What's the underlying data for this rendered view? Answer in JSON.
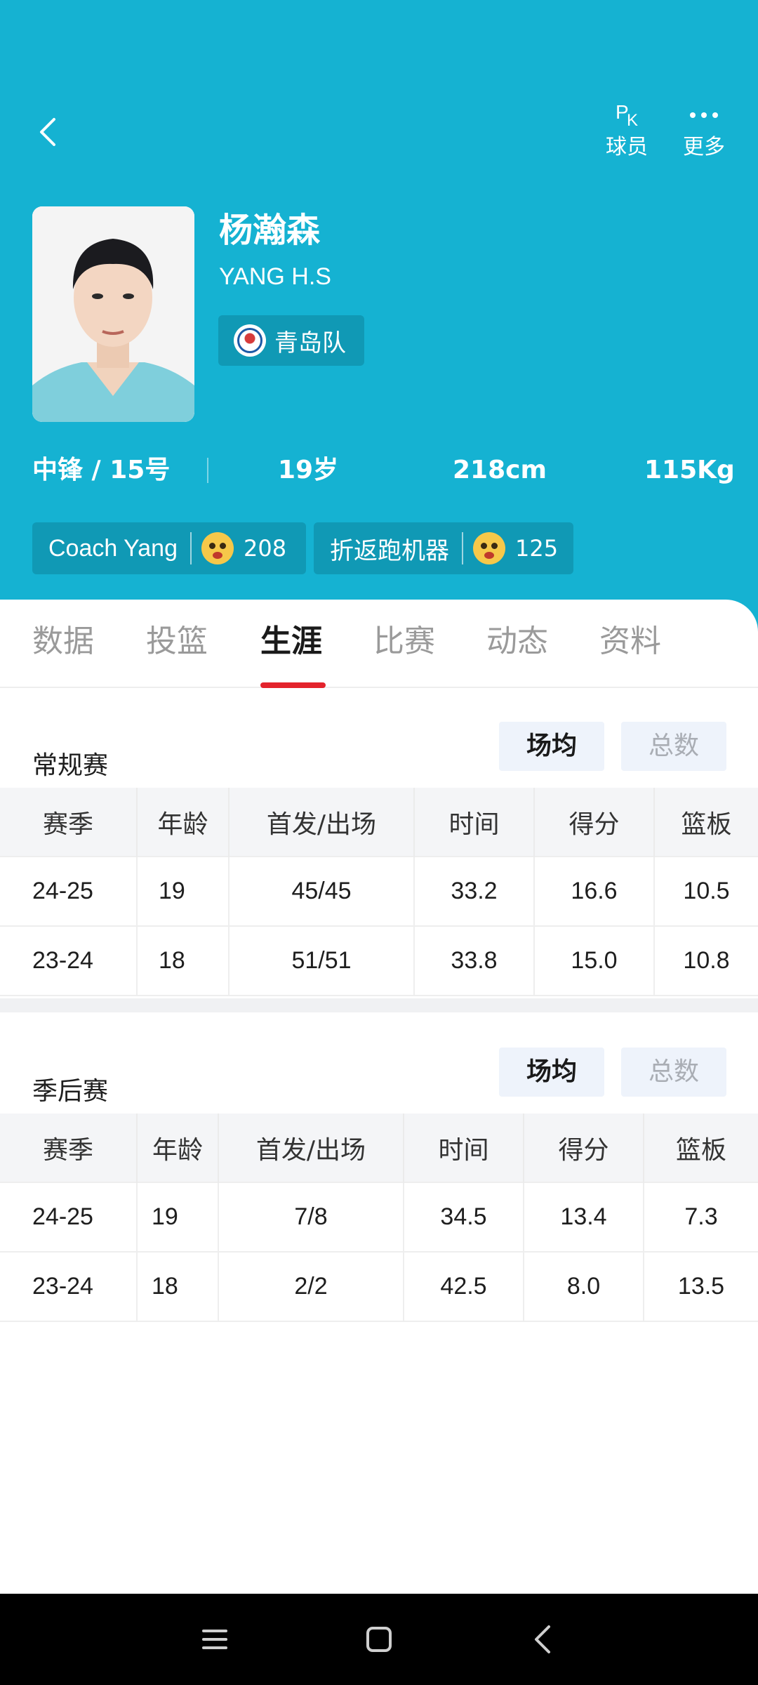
{
  "header": {
    "actions": [
      {
        "label": "球员",
        "glyph_p": "P",
        "glyph_k": "K"
      },
      {
        "label": "更多"
      }
    ],
    "player": {
      "name_cn": "杨瀚森",
      "name_en": "YANG H.S",
      "team": "青岛队"
    },
    "stats": {
      "position": "中锋 / 15号",
      "age": "19岁",
      "height": "218cm",
      "weight": "115Kg"
    },
    "tags": [
      {
        "name": "Coach Yang",
        "count": "208"
      },
      {
        "name": "折返跑机器",
        "count": "125"
      }
    ]
  },
  "tabs": [
    "数据",
    "投篮",
    "生涯",
    "比赛",
    "动态",
    "资料"
  ],
  "active_tab": "生涯",
  "regular": {
    "title": "常规赛",
    "toggle_on": "场均",
    "toggle_off": "总数",
    "columns": [
      "赛季",
      "年龄",
      "首发/出场",
      "时间",
      "得分",
      "篮板"
    ],
    "rows": [
      [
        "24-25",
        "19",
        "45/45",
        "33.2",
        "16.6",
        "10.5"
      ],
      [
        "23-24",
        "18",
        "51/51",
        "33.8",
        "15.0",
        "10.8"
      ]
    ]
  },
  "playoffs": {
    "title": "季后赛",
    "toggle_on": "场均",
    "toggle_off": "总数",
    "columns": [
      "赛季",
      "年龄",
      "首发/出场",
      "时间",
      "得分",
      "篮板"
    ],
    "rows": [
      [
        "24-25",
        "19",
        "7/8",
        "34.5",
        "13.4",
        "7.3"
      ],
      [
        "23-24",
        "18",
        "2/2",
        "42.5",
        "8.0",
        "13.5"
      ]
    ]
  },
  "colors": {
    "header_bg": "#15b2d2",
    "tab_indicator": "#e3232c",
    "toggle_bg": "#eef3fb"
  },
  "icons": {
    "back": "chevron-left-icon",
    "pk": "pk-icon",
    "more": "more-dots-icon",
    "nav": [
      "menu-icon",
      "home-square-icon",
      "back-triangle-icon"
    ]
  }
}
